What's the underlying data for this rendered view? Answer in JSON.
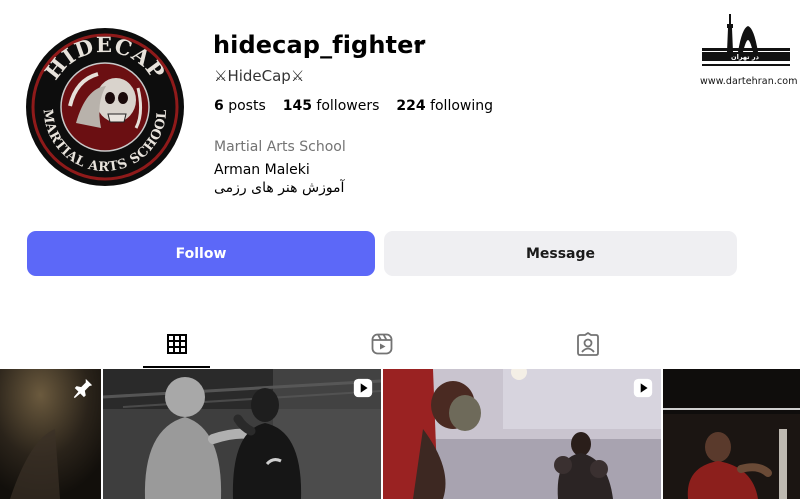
{
  "profile": {
    "username": "hidecap_fighter",
    "full_name": "⚔HideCap⚔",
    "more_icon": "more-horizontal-icon",
    "more_label": "···",
    "avatar": {
      "arc_top": "HIDECAP",
      "arc_bottom": "MARTIAL ARTS SCHOOL",
      "ring_color": "#9b1b1b",
      "bg_color": "#0d0d0d"
    }
  },
  "stats": {
    "posts": {
      "count": "6",
      "label": "posts"
    },
    "followers": {
      "count": "145",
      "label": "followers"
    },
    "following": {
      "count": "224",
      "label": "following"
    }
  },
  "bio": {
    "category": "Martial Arts School",
    "name": "Arman Maleki",
    "text": "آموزش هنر های رزمی"
  },
  "watermark": {
    "persian_text": "در تهران",
    "url": "www.dartehran.com"
  },
  "actions": {
    "follow_label": "Follow",
    "message_label": "Message",
    "follow_color": "#5c68f8",
    "message_color": "#efeff2"
  },
  "tabs": [
    {
      "name": "posts",
      "icon": "grid-icon",
      "active": true
    },
    {
      "name": "reels",
      "icon": "reels-icon",
      "active": false
    },
    {
      "name": "tagged",
      "icon": "tagged-user-icon",
      "active": false
    }
  ],
  "posts": [
    {
      "badge_icon": "pin-icon",
      "tone": "dark-olive"
    },
    {
      "badge_icon": "reel-play-icon",
      "tone": "grayscale"
    },
    {
      "badge_icon": "reel-play-icon",
      "tone": "warm"
    },
    {
      "badge_icon": "none",
      "tone": "dark-red"
    }
  ]
}
